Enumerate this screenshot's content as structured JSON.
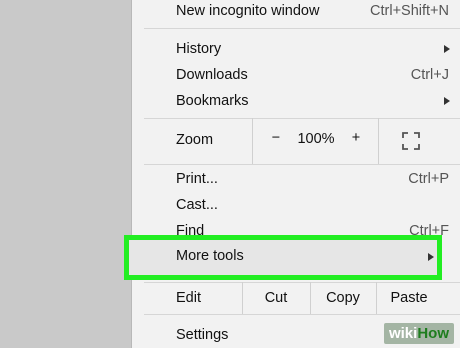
{
  "menu": {
    "new_incognito": {
      "label": "New incognito window",
      "shortcut": "Ctrl+Shift+N"
    },
    "history": {
      "label": "History",
      "submenu_icon": "chevron-right-icon"
    },
    "downloads": {
      "label": "Downloads",
      "shortcut": "Ctrl+J"
    },
    "bookmarks": {
      "label": "Bookmarks",
      "submenu_icon": "chevron-right-icon"
    },
    "zoom": {
      "label": "Zoom",
      "minus": "−",
      "value": "100%",
      "plus": "+",
      "fullscreen_icon": "fullscreen-icon"
    },
    "print": {
      "label": "Print...",
      "shortcut": "Ctrl+P"
    },
    "cast": {
      "label": "Cast..."
    },
    "find": {
      "label": "Find",
      "shortcut": "Ctrl+F"
    },
    "more_tools": {
      "label": "More tools",
      "submenu_icon": "chevron-right-icon"
    },
    "edit": {
      "label": "Edit",
      "cut": "Cut",
      "copy": "Copy",
      "paste": "Paste"
    },
    "settings": {
      "label": "Settings"
    }
  },
  "highlight_color": "#22ee22",
  "watermark": {
    "wiki": "wiki",
    "how": "How"
  }
}
